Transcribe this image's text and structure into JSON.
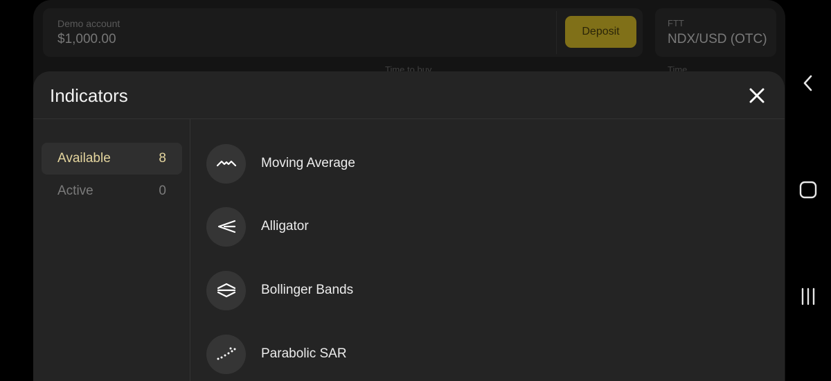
{
  "background": {
    "account_label": "Demo account",
    "balance": "$1,000.00",
    "deposit_label": "Deposit",
    "asset_type": "FTT",
    "asset_name": "NDX/USD (OTC)",
    "peek_text_1": "Time to buy",
    "peek_text_2": "Time"
  },
  "modal": {
    "title": "Indicators",
    "close_icon": "close-icon",
    "tabs": [
      {
        "label": "Available",
        "count": "8",
        "selected": true
      },
      {
        "label": "Active",
        "count": "0",
        "selected": false
      }
    ],
    "indicators": [
      {
        "label": "Moving Average",
        "icon": "moving-average-icon"
      },
      {
        "label": "Alligator",
        "icon": "alligator-icon"
      },
      {
        "label": "Bollinger Bands",
        "icon": "bollinger-bands-icon"
      },
      {
        "label": "Parabolic SAR",
        "icon": "parabolic-sar-icon"
      }
    ]
  },
  "system_nav": {
    "back": "back-icon",
    "home": "home-icon",
    "recents": "recents-icon"
  },
  "colors": {
    "accent_gold": "#e4d59e",
    "deposit_bg": "#807018",
    "modal_bg": "#242424"
  }
}
